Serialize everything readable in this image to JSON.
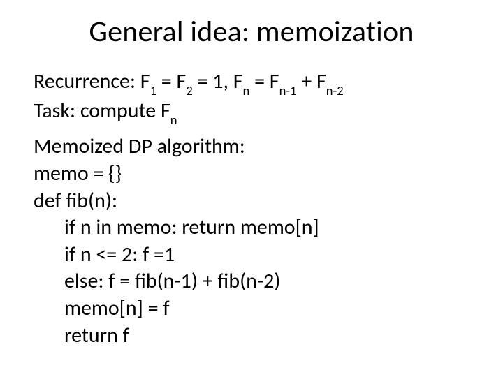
{
  "title": "General idea: memoization",
  "recurrence": {
    "label": "Recurrence:  ",
    "f1": "F",
    "sub1": "1",
    "eq1": " = F",
    "sub2": "2",
    "mid": " = 1,   F",
    "subn": "n",
    "eq2": " = F",
    "subnm1": "n-1",
    "plus": " + F",
    "subnm2": "n-2"
  },
  "task": {
    "label": "Task: compute F",
    "sub": "n"
  },
  "algo_heading": "Memoized DP algorithm:",
  "code": {
    "l1": "memo = {}",
    "l2": "def fib(n):",
    "l3": "if n in memo: return memo[n]",
    "l4": "if n <= 2:  f =1",
    "l5": "else: f = fib(n-1) + fib(n-2)",
    "l6": "memo[n] = f",
    "l7": "return f"
  }
}
